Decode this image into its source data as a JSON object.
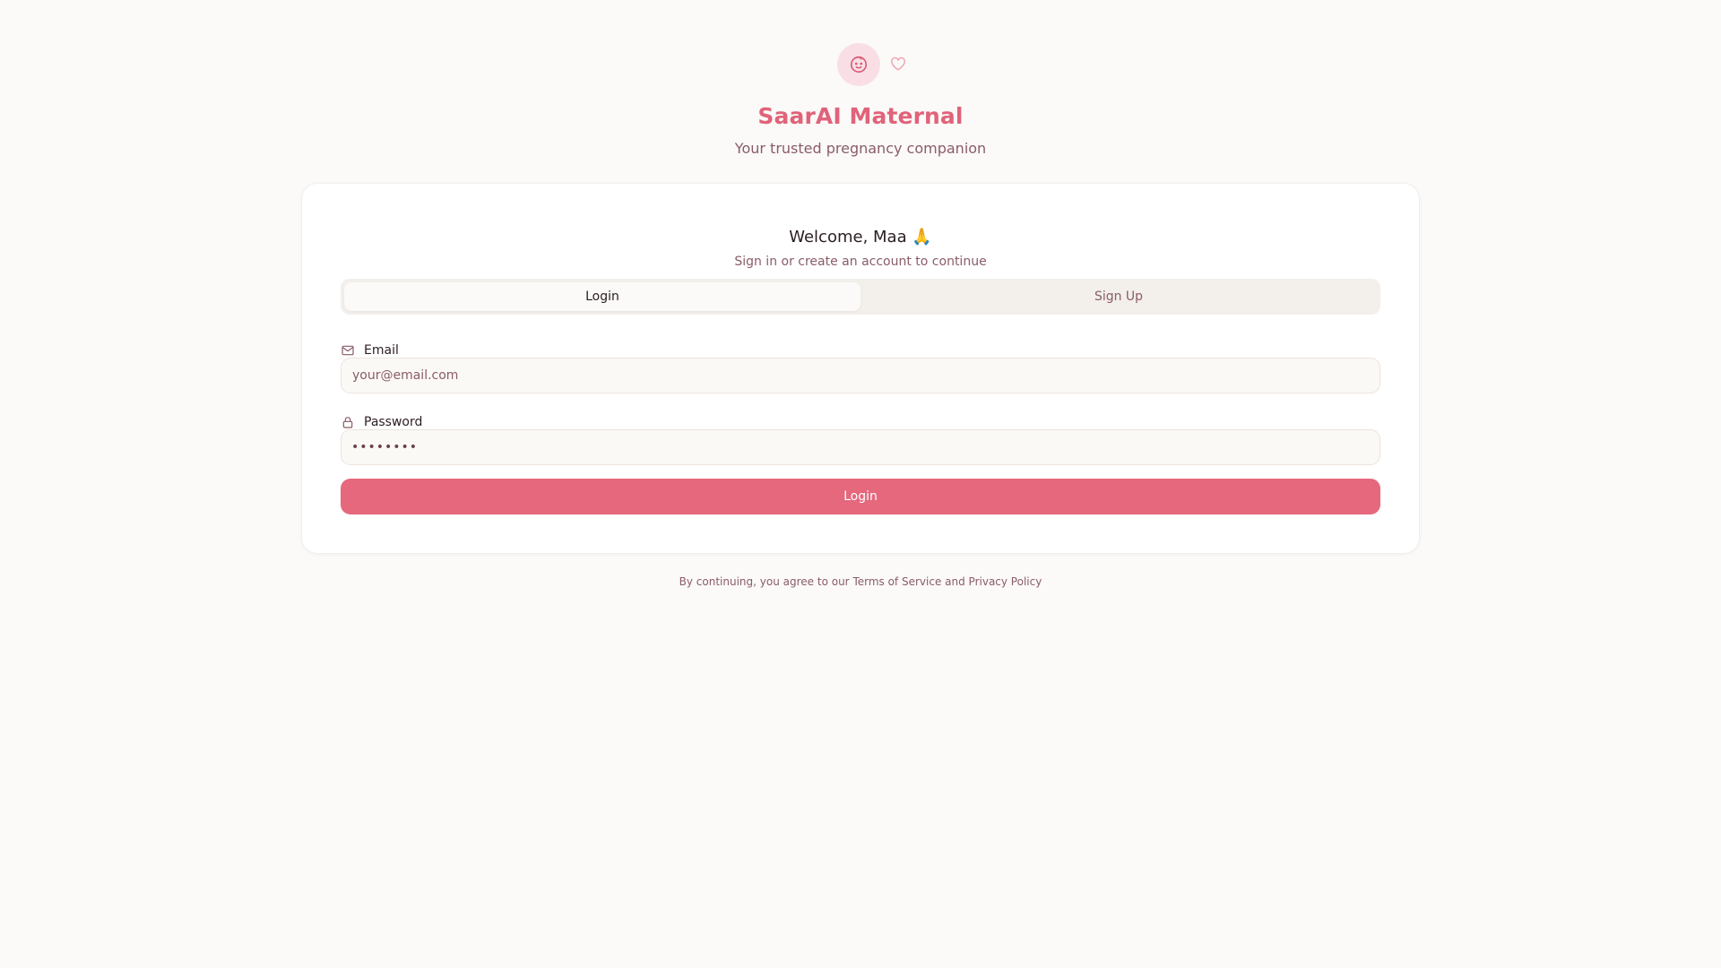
{
  "brand": {
    "title": "SaarAI Maternal",
    "subtitle": "Your trusted pregnancy companion",
    "logo_icon": "baby-face-icon",
    "accent_icon": "heart-icon"
  },
  "card": {
    "welcome": "Welcome, Maa 🙏",
    "subtitle": "Sign in or create an account to continue"
  },
  "tabs": [
    {
      "label": "Login",
      "active": true
    },
    {
      "label": "Sign Up",
      "active": false
    }
  ],
  "form": {
    "email": {
      "label": "Email",
      "icon": "mail-icon",
      "value": "",
      "placeholder": "your@email.com"
    },
    "password": {
      "label": "Password",
      "icon": "lock-icon",
      "display_value": "••••••••"
    },
    "submit_label": "Login"
  },
  "footer": {
    "prefix": "By continuing, you agree to our ",
    "terms": "Terms of Service",
    "and": " and ",
    "privacy": "Privacy Policy"
  },
  "colors": {
    "accent": "#e5687d",
    "brand_title": "#e0637a",
    "muted_text": "#8a5c68",
    "background": "#fbfaf8"
  }
}
